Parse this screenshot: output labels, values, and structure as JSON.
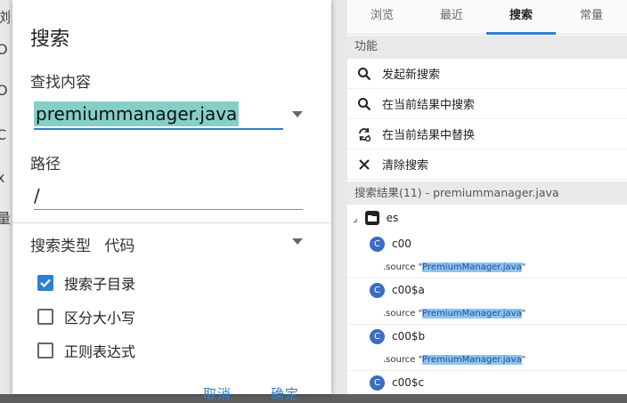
{
  "dialog": {
    "title": "搜索",
    "query_label": "查找内容",
    "query_value": "premiummanager.java",
    "path_label": "路径",
    "path_value": "/",
    "type_label": "搜索类型",
    "type_value": "代码",
    "options": [
      {
        "label": "搜索子目录",
        "checked": true
      },
      {
        "label": "区分大小写",
        "checked": false
      },
      {
        "label": "正则表达式",
        "checked": false
      }
    ],
    "cancel_label": "取消",
    "ok_label": "确定"
  },
  "edge_chars": [
    "浏",
    "O",
    "O",
    "C",
    "x",
    "量"
  ],
  "panel": {
    "tabs": [
      {
        "label": "浏览",
        "active": false
      },
      {
        "label": "最近",
        "active": false
      },
      {
        "label": "搜索",
        "active": true
      },
      {
        "label": "常量",
        "active": false
      }
    ],
    "functions_header": "功能",
    "actions": [
      {
        "label": "发起新搜索",
        "icon": "search-icon"
      },
      {
        "label": "在当前结果中搜索",
        "icon": "search-icon"
      },
      {
        "label": "在当前结果中替换",
        "icon": "replace-icon"
      },
      {
        "label": "清除搜索",
        "icon": "close-icon"
      }
    ],
    "results_header": "搜索结果(11) - premiummanager.java",
    "tree": {
      "expander": "⌟",
      "folder": "es",
      "items": [
        {
          "class_badge": "C",
          "name": "c00",
          "source_prefix": ".source \"",
          "source_match": "PremiumManager.java",
          "source_suffix": "\""
        },
        {
          "class_badge": "C",
          "name": "c00$a",
          "source_prefix": ".source \"",
          "source_match": "PremiumManager.java",
          "source_suffix": "\""
        },
        {
          "class_badge": "C",
          "name": "c00$b",
          "source_prefix": ".source \"",
          "source_match": "PremiumManager.java",
          "source_suffix": "\""
        },
        {
          "class_badge": "C",
          "name": "c00$c"
        }
      ]
    }
  },
  "colors": {
    "accent": "#2f7fd0",
    "selection": "#86cfc9",
    "match_highlight": "#8fc2f2",
    "class_badge": "#3a6cc4"
  }
}
